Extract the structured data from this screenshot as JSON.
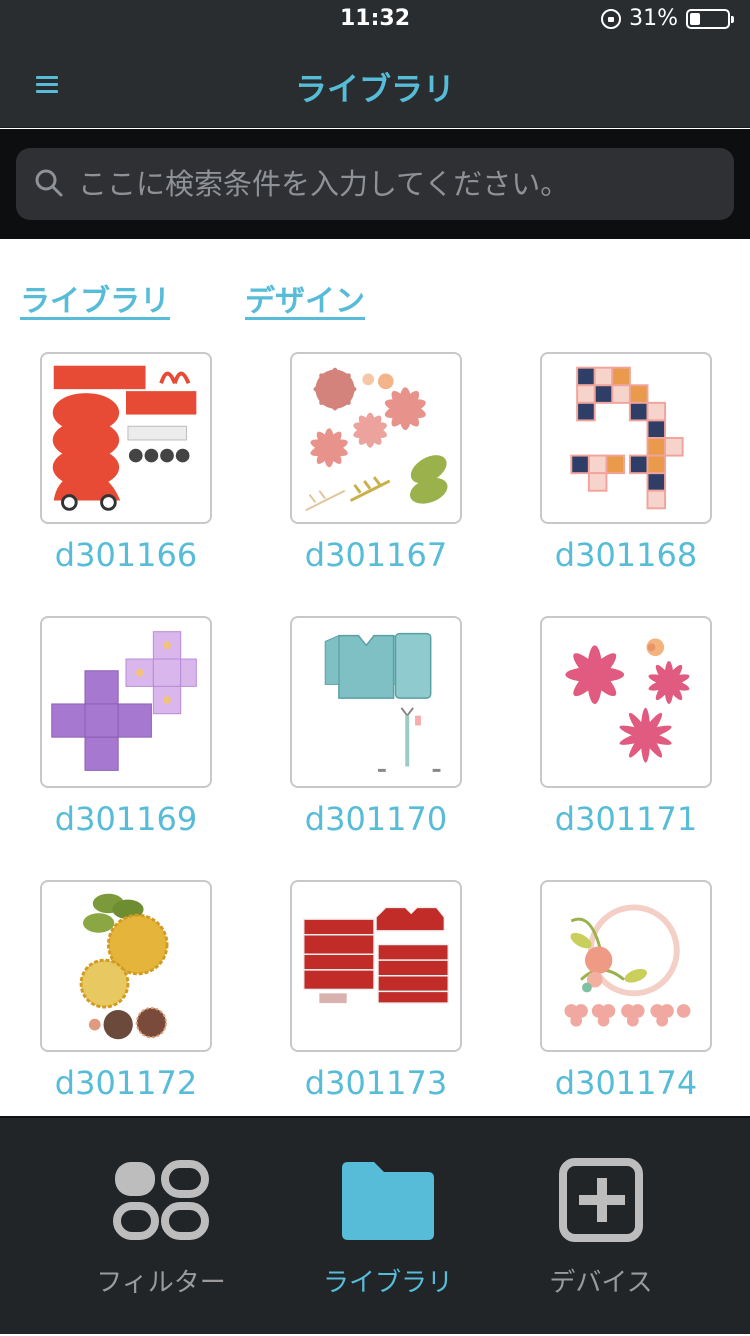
{
  "status": {
    "time": "11:32",
    "battery": "31%"
  },
  "nav": {
    "title": "ライブラリ"
  },
  "search": {
    "placeholder": "ここに検索条件を入力してください。"
  },
  "tabs": [
    {
      "label": "ライブラリ"
    },
    {
      "label": "デザイン"
    }
  ],
  "items": [
    {
      "label": "d301166"
    },
    {
      "label": "d301167"
    },
    {
      "label": "d301168"
    },
    {
      "label": "d301169"
    },
    {
      "label": "d301170"
    },
    {
      "label": "d301171"
    },
    {
      "label": "d301172"
    },
    {
      "label": "d301173"
    },
    {
      "label": "d301174"
    }
  ],
  "tabbar": [
    {
      "label": "フィルター",
      "icon": "filter-icon"
    },
    {
      "label": "ライブラリ",
      "icon": "folder-icon"
    },
    {
      "label": "デバイス",
      "icon": "device-add-icon"
    }
  ],
  "colors": {
    "accent": "#56bcd8",
    "bar": "#2a2d30",
    "inactive": "#9a9a9a"
  }
}
